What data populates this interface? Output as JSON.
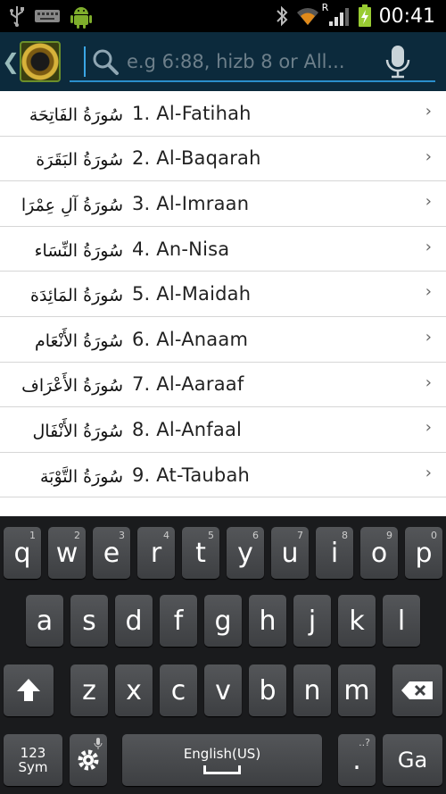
{
  "status_bar": {
    "time": "00:41",
    "icons": [
      "usb-icon",
      "keyboard-icon",
      "android-debug-icon",
      "bluetooth-icon",
      "wifi-icon",
      "signal-icon",
      "battery-icon"
    ],
    "roaming_label": "R"
  },
  "action_bar": {
    "back_glyph": "❮",
    "logo": "quran-app-logo",
    "search": {
      "placeholder": "e.g 6:88, hizb 8 or All..."
    },
    "accent_color": "#2a8ecb"
  },
  "suras": [
    {
      "label": "1. Al-Fatihah",
      "calligraphy": "سُورَةُ الفَاتِحَة"
    },
    {
      "label": "2. Al-Baqarah",
      "calligraphy": "سُورَةُ البَقَرَة"
    },
    {
      "label": "3. Al-Imraan",
      "calligraphy": "سُورَةُ آلِ عِمْرَان"
    },
    {
      "label": "4. An-Nisa",
      "calligraphy": "سُورَةُ النِّسَاء"
    },
    {
      "label": "5. Al-Maidah",
      "calligraphy": "سُورَةُ المَائِدَة"
    },
    {
      "label": "6. Al-Anaam",
      "calligraphy": "سُورَةُ الأَنْعَام"
    },
    {
      "label": "7. Al-Aaraaf",
      "calligraphy": "سُورَةُ الأَعْرَاف"
    },
    {
      "label": "8. Al-Anfaal",
      "calligraphy": "سُورَةُ الأَنْفَال"
    },
    {
      "label": "9. At-Taubah",
      "calligraphy": "سُورَةُ التَّوْبَة"
    }
  ],
  "row_chevron": "›",
  "keyboard": {
    "row1": [
      {
        "key": "q",
        "hint": "1"
      },
      {
        "key": "w",
        "hint": "2"
      },
      {
        "key": "e",
        "hint": "3"
      },
      {
        "key": "r",
        "hint": "4"
      },
      {
        "key": "t",
        "hint": "5"
      },
      {
        "key": "y",
        "hint": "6"
      },
      {
        "key": "u",
        "hint": "7"
      },
      {
        "key": "i",
        "hint": "8"
      },
      {
        "key": "o",
        "hint": "9"
      },
      {
        "key": "p",
        "hint": "0"
      }
    ],
    "row2": [
      "a",
      "s",
      "d",
      "f",
      "g",
      "h",
      "j",
      "k",
      "l"
    ],
    "row3": [
      "z",
      "x",
      "c",
      "v",
      "b",
      "n",
      "m"
    ],
    "sym_label": "123\nSym",
    "space_label": "English(US)",
    "period_label": ".",
    "period_hint": "..?",
    "go_label": "Ga"
  }
}
